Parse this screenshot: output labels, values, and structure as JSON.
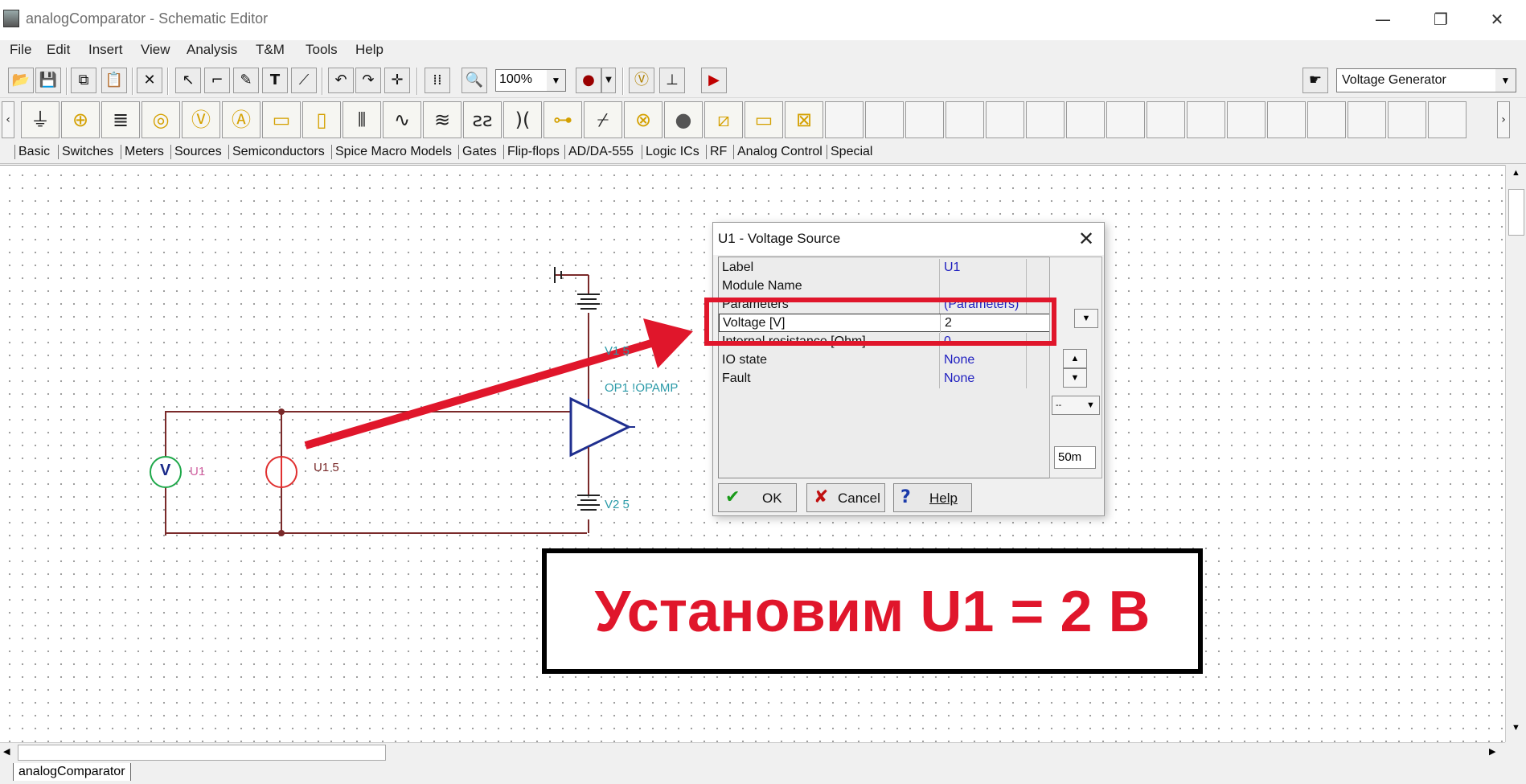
{
  "window": {
    "title": "analogComparator - Schematic Editor",
    "minimize": "—",
    "restore": "❐",
    "close": "✕"
  },
  "menu": [
    "File",
    "Edit",
    "Insert",
    "View",
    "Analysis",
    "T&M",
    "Tools",
    "Help"
  ],
  "toolbar": {
    "zoom": "100%",
    "generator_select": "Voltage Generator"
  },
  "palette_tabs": [
    "Basic",
    "Switches",
    "Meters",
    "Sources",
    "Semiconductors",
    "Spice Macro Models",
    "Gates",
    "Flip-flops",
    "AD/DA-555",
    "Logic ICs",
    "RF",
    "Analog Control",
    "Special"
  ],
  "schematic": {
    "voltmeter_symbol": "V",
    "voltmeter_label": "U1",
    "source_label": "U1 5",
    "v1_label": "V1 5",
    "opamp_label": "OP1 !OPAMP",
    "v2_label": "V2 5"
  },
  "dialog": {
    "title": "U1 - Voltage Source",
    "properties": [
      {
        "name": "Label",
        "value": "U1"
      },
      {
        "name": "Module Name",
        "value": ""
      },
      {
        "name": "Parameters",
        "value": "(Parameters)"
      },
      {
        "name": "Voltage [V]",
        "value": "2"
      },
      {
        "name": "Internal resistance [Ohm]",
        "value": "0"
      },
      {
        "name": "IO state",
        "value": "None"
      },
      {
        "name": "Fault",
        "value": "None"
      }
    ],
    "step_value": "50m",
    "small_select": "--",
    "buttons": {
      "ok": "OK",
      "cancel": "Cancel",
      "help": "Help"
    }
  },
  "annotation": {
    "caption": "Установим U1 = 2 В"
  },
  "document_tab": "analogComparator",
  "colors": {
    "accent_red": "#e0162b",
    "schematic_wire": "#7a2a2a",
    "component_teal": "#2a9aa8"
  }
}
